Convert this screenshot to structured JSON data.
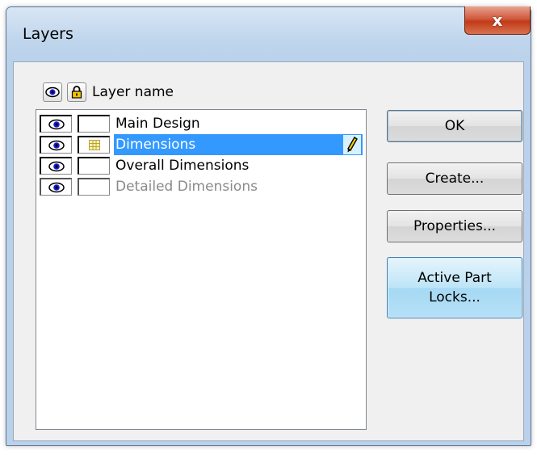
{
  "window": {
    "title": "Layers",
    "close_label": "x"
  },
  "header": {
    "layer_name_label": "Layer name"
  },
  "layers": [
    {
      "name": "Main Design",
      "visible": true,
      "locked": false,
      "state": "normal"
    },
    {
      "name": "Dimensions",
      "visible": true,
      "locked": true,
      "state": "selected-active"
    },
    {
      "name": "Overall Dimensions",
      "visible": true,
      "locked": false,
      "state": "normal"
    },
    {
      "name": "Detailed Dimensions",
      "visible": true,
      "locked": false,
      "state": "disabled"
    }
  ],
  "buttons": {
    "ok": "OK",
    "create": "Create...",
    "properties": "Properties...",
    "active_part_locks_line1": "Active Part",
    "active_part_locks_line2": "Locks..."
  },
  "icons": {
    "eye": "eye-icon",
    "lock": "lock-icon",
    "pencil": "pencil-icon",
    "lock_state": "lock-grid-icon"
  },
  "colors": {
    "selection": "#3399ff",
    "window_frame": "#b9d1ea",
    "client_bg": "#f0f0f0",
    "close_button": "#c23a18",
    "active_button": "#a6d9f4"
  }
}
